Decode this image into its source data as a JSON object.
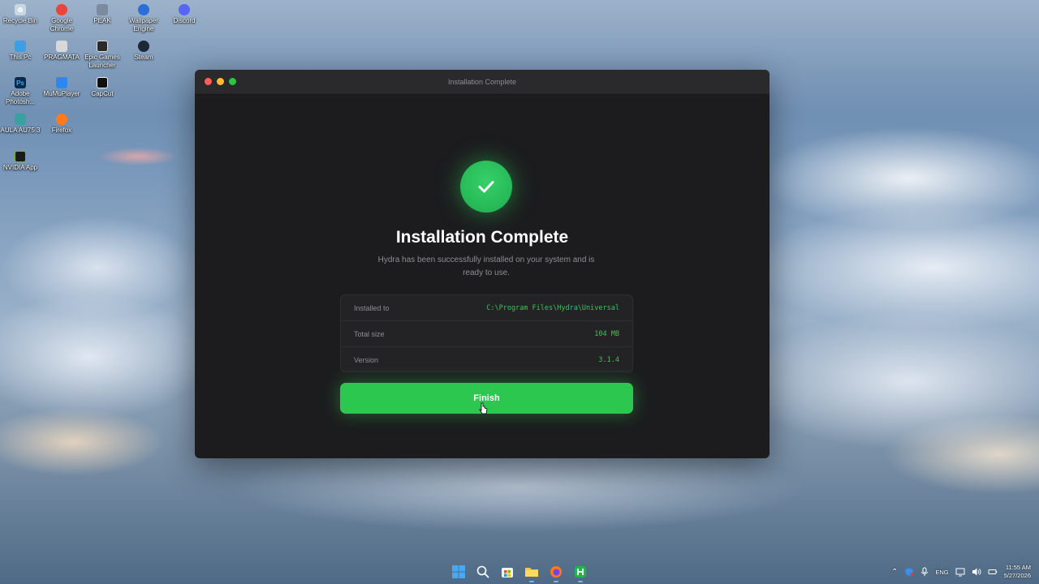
{
  "desktop": {
    "icons": [
      {
        "label": "Recycle Bin",
        "icon": "recycle-bin-icon",
        "color": "#c9d6e4"
      },
      {
        "label": "Google Chrome",
        "icon": "chrome-icon",
        "color": "#e8453c"
      },
      {
        "label": "PEAK",
        "icon": "peak-icon",
        "color": "#7c8aa0"
      },
      {
        "label": "Wallpaper Engine",
        "icon": "wallpaper-engine-icon",
        "color": "#2a6fd6"
      },
      {
        "label": "Discord",
        "icon": "discord-icon",
        "color": "#5865f2"
      },
      {
        "label": "This Pc",
        "icon": "this-pc-icon",
        "color": "#3aa0e6"
      },
      {
        "label": "PRAGMATA",
        "icon": "pragmata-icon",
        "color": "#d8d8d8"
      },
      {
        "label": "Epic Games Launcher",
        "icon": "epic-games-icon",
        "color": "#2a2a2a"
      },
      {
        "label": "Steam",
        "icon": "steam-icon",
        "color": "#1b2838"
      },
      {
        "label": "Adobe Photosh...",
        "icon": "photoshop-icon",
        "color": "#0b2a4a"
      },
      {
        "label": "MuMuPlayer",
        "icon": "mumuplayer-icon",
        "color": "#2f86f0"
      },
      {
        "label": "CapCut",
        "icon": "capcut-icon",
        "color": "#111111"
      },
      {
        "label": "AULA AU75 3",
        "icon": "aula-icon",
        "color": "#3aa0a0"
      },
      {
        "label": "Firefox",
        "icon": "firefox-icon",
        "color": "#ff7a1a"
      },
      {
        "label": "NVIDIA App",
        "icon": "nvidia-icon",
        "color": "#76b900"
      }
    ]
  },
  "window": {
    "title": "Installation Complete",
    "heading": "Installation Complete",
    "subtitle": "Hydra has been successfully installed on your system and is ready to use.",
    "info": [
      {
        "key": "Installed to",
        "value": "C:\\Program Files\\Hydra\\Universal"
      },
      {
        "key": "Total size",
        "value": "104 MB"
      },
      {
        "key": "Version",
        "value": "3.1.4"
      }
    ],
    "finish_label": "Finish",
    "accent": "#2cc74f"
  },
  "taskbar": {
    "apps": [
      "windows-start-icon",
      "search-icon",
      "store-icon",
      "file-explorer-icon",
      "firefox-icon",
      "hydra-icon"
    ],
    "tray": {
      "language": "ENG",
      "time": "11:55 AM",
      "date": "5/27/2026"
    }
  }
}
